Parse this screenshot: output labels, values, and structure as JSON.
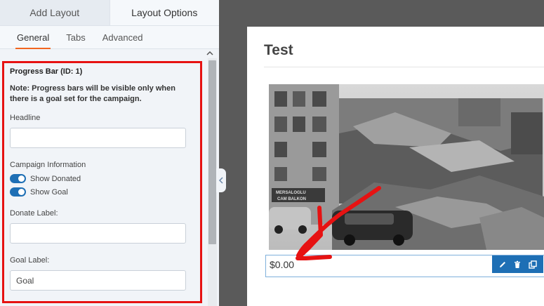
{
  "top_tabs": [
    {
      "label": "Add Layout"
    },
    {
      "label": "Layout Options"
    }
  ],
  "sub_tabs": [
    {
      "label": "General"
    },
    {
      "label": "Tabs"
    },
    {
      "label": "Advanced"
    }
  ],
  "settings": {
    "section_title": "Progress Bar (ID: 1)",
    "note": "Note: Progress bars will be visible only when there is a goal set for the campaign.",
    "headline_label": "Headline",
    "headline_value": "",
    "campaign_info_label": "Campaign Information",
    "show_donated_label": "Show Donated",
    "show_donated": true,
    "show_goal_label": "Show Goal",
    "show_goal": true,
    "donate_label_label": "Donate Label:",
    "donate_label_value": "",
    "goal_label_label": "Goal Label:",
    "goal_label_value": "Goal"
  },
  "preview": {
    "title": "Test",
    "amount": "$0.00",
    "actions": [
      "edit-icon",
      "trash-icon",
      "duplicate-icon"
    ],
    "photo_caption": "MERSALOGLU CAM BALKON"
  },
  "colors": {
    "accent": "#1e6fb5",
    "tab_underline": "#f2661f",
    "highlight": "#e61212"
  }
}
